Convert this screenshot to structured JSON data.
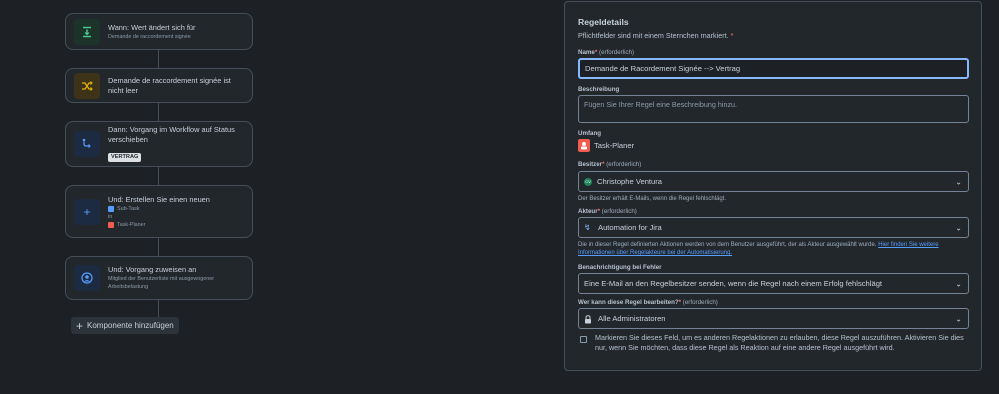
{
  "flow": {
    "trigger": {
      "title": "Wann: Wert ändert sich für",
      "sub": "Demande de raccordement signée"
    },
    "condition": {
      "title": "Demande de raccordement signée ist nicht leer"
    },
    "action1": {
      "title": "Dann: Vorgang im Workflow auf Status verschieben",
      "status": "VERTRAG"
    },
    "action2": {
      "title": "Und: Erstellen Sie einen neuen",
      "type": "Sub-Task",
      "in": "in",
      "project": "Task-Planer"
    },
    "action3": {
      "title": "Und: Vorgang zuweisen an",
      "sub": "Mitglied der Benutzerliste mit ausgewogener Arbeitsbelastung"
    },
    "add_component": "Komponente hinzufügen"
  },
  "details": {
    "title": "Regeldetails",
    "required_note": "Pflichtfelder sind mit einem Sternchen markiert.",
    "asterisk": "*",
    "name": {
      "label": "Name",
      "optional": "(erforderlich)",
      "value": "Demande de Racordement Signée --> Vertrag"
    },
    "description": {
      "label": "Beschreibung",
      "placeholder": "Fügen Sie Ihrer Regel eine Beschreibung hinzu."
    },
    "scope": {
      "label": "Umfang",
      "value": "Task-Planer"
    },
    "owner": {
      "label": "Besitzer",
      "optional": "(erforderlich)",
      "value": "Christophe Ventura",
      "initials": "CV",
      "helper": "Der Besitzer erhält E-Mails, wenn die Regel fehlschlägt."
    },
    "actor": {
      "label": "Akteur",
      "optional": "(erforderlich)",
      "value": "Automation for Jira",
      "helper": "Die in dieser Regel definierten Aktionen werden von dem Benutzer ausgeführt, der als Akteur ausgewählt wurde.",
      "link": "Hier finden Sie weitere Informationen über Regelakteure bei der Automatisierung."
    },
    "notify": {
      "label": "Benachrichtigung bei Fehler",
      "value": "Eine E-Mail an den Regelbesitzer senden, wenn die Regel nach einem Erfolg fehlschlägt"
    },
    "editors": {
      "label": "Wer kann diese Regel bearbeiten?",
      "optional": "(erforderlich)",
      "value": "Alle Administratoren"
    },
    "checkbox_text": "Markieren Sie dieses Feld, um es anderen Regelaktionen zu erlauben, diese Regel auszuführen. Aktivieren Sie dies nur, wenn Sie möchten, dass diese Regel als Reaktion auf eine andere Regel ausgeführt wird."
  },
  "colors": {
    "accent": "#85b8ff",
    "required": "#f87168",
    "link": "#579dff",
    "background": "#1d2125",
    "surface": "#22272b"
  }
}
